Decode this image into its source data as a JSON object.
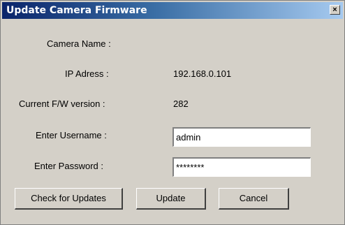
{
  "window": {
    "title": "Update Camera Firmware",
    "close_glyph": "×"
  },
  "form": {
    "camera_name_label": "Camera Name :",
    "camera_name_value": "",
    "ip_label": "IP Adress :",
    "ip_value": "192.168.0.101",
    "fw_label": "Current F/W version :",
    "fw_value": "282",
    "username_label": "Enter Username :",
    "username_value": "admin",
    "password_label": "Enter Password :",
    "password_value": "********"
  },
  "buttons": {
    "check_updates": "Check for Updates",
    "update": "Update",
    "cancel": "Cancel"
  },
  "colors": {
    "title_bar_start": "#0a246a",
    "title_bar_end": "#a6caf0",
    "dialog_bg": "#d4d0c8"
  }
}
